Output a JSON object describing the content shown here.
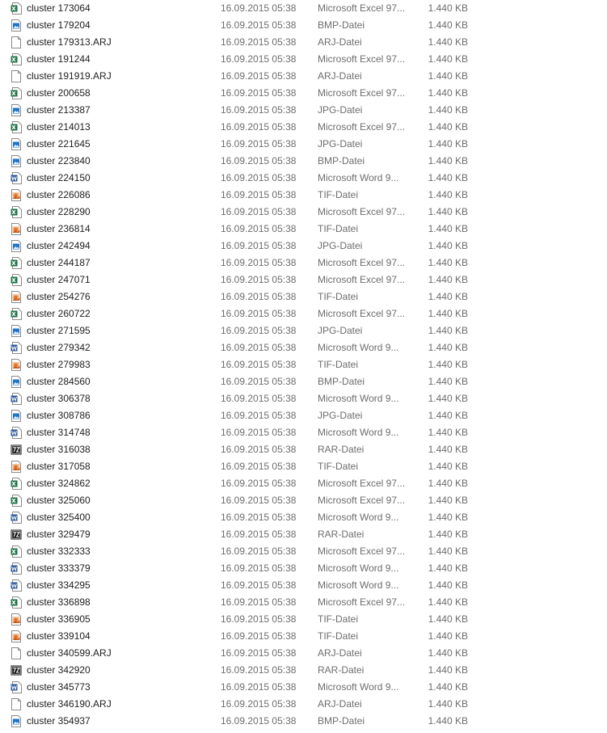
{
  "files": [
    {
      "name": "cluster 173064",
      "date": "16.09.2015 05:38",
      "type": "Microsoft Excel 97...",
      "size": "1.440 KB",
      "icon": "excel-icon"
    },
    {
      "name": "cluster 179204",
      "date": "16.09.2015 05:38",
      "type": "BMP-Datei",
      "size": "1.440 KB",
      "icon": "image-icon"
    },
    {
      "name": "cluster 179313.ARJ",
      "date": "16.09.2015 05:38",
      "type": "ARJ-Datei",
      "size": "1.440 KB",
      "icon": "blank-file-icon"
    },
    {
      "name": "cluster 191244",
      "date": "16.09.2015 05:38",
      "type": "Microsoft Excel 97...",
      "size": "1.440 KB",
      "icon": "excel-icon"
    },
    {
      "name": "cluster 191919.ARJ",
      "date": "16.09.2015 05:38",
      "type": "ARJ-Datei",
      "size": "1.440 KB",
      "icon": "blank-file-icon"
    },
    {
      "name": "cluster 200658",
      "date": "16.09.2015 05:38",
      "type": "Microsoft Excel 97...",
      "size": "1.440 KB",
      "icon": "excel-icon"
    },
    {
      "name": "cluster 213387",
      "date": "16.09.2015 05:38",
      "type": "JPG-Datei",
      "size": "1.440 KB",
      "icon": "image-icon"
    },
    {
      "name": "cluster 214013",
      "date": "16.09.2015 05:38",
      "type": "Microsoft Excel 97...",
      "size": "1.440 KB",
      "icon": "excel-icon"
    },
    {
      "name": "cluster 221645",
      "date": "16.09.2015 05:38",
      "type": "JPG-Datei",
      "size": "1.440 KB",
      "icon": "image-icon"
    },
    {
      "name": "cluster 223840",
      "date": "16.09.2015 05:38",
      "type": "BMP-Datei",
      "size": "1.440 KB",
      "icon": "image-icon"
    },
    {
      "name": "cluster 224150",
      "date": "16.09.2015 05:38",
      "type": "Microsoft Word 9...",
      "size": "1.440 KB",
      "icon": "word-icon"
    },
    {
      "name": "cluster 226086",
      "date": "16.09.2015 05:38",
      "type": "TIF-Datei",
      "size": "1.440 KB",
      "icon": "tif-icon"
    },
    {
      "name": "cluster 228290",
      "date": "16.09.2015 05:38",
      "type": "Microsoft Excel 97...",
      "size": "1.440 KB",
      "icon": "excel-icon"
    },
    {
      "name": "cluster 236814",
      "date": "16.09.2015 05:38",
      "type": "TIF-Datei",
      "size": "1.440 KB",
      "icon": "tif-icon"
    },
    {
      "name": "cluster 242494",
      "date": "16.09.2015 05:38",
      "type": "JPG-Datei",
      "size": "1.440 KB",
      "icon": "image-icon"
    },
    {
      "name": "cluster 244187",
      "date": "16.09.2015 05:38",
      "type": "Microsoft Excel 97...",
      "size": "1.440 KB",
      "icon": "excel-icon"
    },
    {
      "name": "cluster 247071",
      "date": "16.09.2015 05:38",
      "type": "Microsoft Excel 97...",
      "size": "1.440 KB",
      "icon": "excel-icon"
    },
    {
      "name": "cluster 254276",
      "date": "16.09.2015 05:38",
      "type": "TIF-Datei",
      "size": "1.440 KB",
      "icon": "tif-icon"
    },
    {
      "name": "cluster 260722",
      "date": "16.09.2015 05:38",
      "type": "Microsoft Excel 97...",
      "size": "1.440 KB",
      "icon": "excel-icon"
    },
    {
      "name": "cluster 271595",
      "date": "16.09.2015 05:38",
      "type": "JPG-Datei",
      "size": "1.440 KB",
      "icon": "image-icon"
    },
    {
      "name": "cluster 279342",
      "date": "16.09.2015 05:38",
      "type": "Microsoft Word 9...",
      "size": "1.440 KB",
      "icon": "word-icon"
    },
    {
      "name": "cluster 279983",
      "date": "16.09.2015 05:38",
      "type": "TIF-Datei",
      "size": "1.440 KB",
      "icon": "tif-icon"
    },
    {
      "name": "cluster 284560",
      "date": "16.09.2015 05:38",
      "type": "BMP-Datei",
      "size": "1.440 KB",
      "icon": "image-icon"
    },
    {
      "name": "cluster 306378",
      "date": "16.09.2015 05:38",
      "type": "Microsoft Word 9...",
      "size": "1.440 KB",
      "icon": "word-icon"
    },
    {
      "name": "cluster 308786",
      "date": "16.09.2015 05:38",
      "type": "JPG-Datei",
      "size": "1.440 KB",
      "icon": "image-icon"
    },
    {
      "name": "cluster 314748",
      "date": "16.09.2015 05:38",
      "type": "Microsoft Word 9...",
      "size": "1.440 KB",
      "icon": "word-icon"
    },
    {
      "name": "cluster 316038",
      "date": "16.09.2015 05:38",
      "type": "RAR-Datei",
      "size": "1.440 KB",
      "icon": "7z-archive-icon"
    },
    {
      "name": "cluster 317058",
      "date": "16.09.2015 05:38",
      "type": "TIF-Datei",
      "size": "1.440 KB",
      "icon": "tif-icon"
    },
    {
      "name": "cluster 324862",
      "date": "16.09.2015 05:38",
      "type": "Microsoft Excel 97...",
      "size": "1.440 KB",
      "icon": "excel-icon"
    },
    {
      "name": "cluster 325060",
      "date": "16.09.2015 05:38",
      "type": "Microsoft Excel 97...",
      "size": "1.440 KB",
      "icon": "excel-icon"
    },
    {
      "name": "cluster 325400",
      "date": "16.09.2015 05:38",
      "type": "Microsoft Word 9...",
      "size": "1.440 KB",
      "icon": "word-icon"
    },
    {
      "name": "cluster 329479",
      "date": "16.09.2015 05:38",
      "type": "RAR-Datei",
      "size": "1.440 KB",
      "icon": "7z-archive-icon"
    },
    {
      "name": "cluster 332333",
      "date": "16.09.2015 05:38",
      "type": "Microsoft Excel 97...",
      "size": "1.440 KB",
      "icon": "excel-icon"
    },
    {
      "name": "cluster 333379",
      "date": "16.09.2015 05:38",
      "type": "Microsoft Word 9...",
      "size": "1.440 KB",
      "icon": "word-icon"
    },
    {
      "name": "cluster 334295",
      "date": "16.09.2015 05:38",
      "type": "Microsoft Word 9...",
      "size": "1.440 KB",
      "icon": "word-icon"
    },
    {
      "name": "cluster 336898",
      "date": "16.09.2015 05:38",
      "type": "Microsoft Excel 97...",
      "size": "1.440 KB",
      "icon": "excel-icon"
    },
    {
      "name": "cluster 336905",
      "date": "16.09.2015 05:38",
      "type": "TIF-Datei",
      "size": "1.440 KB",
      "icon": "tif-icon"
    },
    {
      "name": "cluster 339104",
      "date": "16.09.2015 05:38",
      "type": "TIF-Datei",
      "size": "1.440 KB",
      "icon": "tif-icon"
    },
    {
      "name": "cluster 340599.ARJ",
      "date": "16.09.2015 05:38",
      "type": "ARJ-Datei",
      "size": "1.440 KB",
      "icon": "blank-file-icon"
    },
    {
      "name": "cluster 342920",
      "date": "16.09.2015 05:38",
      "type": "RAR-Datei",
      "size": "1.440 KB",
      "icon": "7z-archive-icon"
    },
    {
      "name": "cluster 345773",
      "date": "16.09.2015 05:38",
      "type": "Microsoft Word 9...",
      "size": "1.440 KB",
      "icon": "word-icon"
    },
    {
      "name": "cluster 346190.ARJ",
      "date": "16.09.2015 05:38",
      "type": "ARJ-Datei",
      "size": "1.440 KB",
      "icon": "blank-file-icon"
    },
    {
      "name": "cluster 354937",
      "date": "16.09.2015 05:38",
      "type": "BMP-Datei",
      "size": "1.440 KB",
      "icon": "image-icon"
    }
  ],
  "colors": {
    "excel": "#1e7145",
    "word": "#2b579a",
    "image": "#1f74c6",
    "tif_orange": "#e8742a",
    "archive": "#111111",
    "text_primary": "#1e1e1e",
    "text_secondary": "#6d6d6d"
  }
}
